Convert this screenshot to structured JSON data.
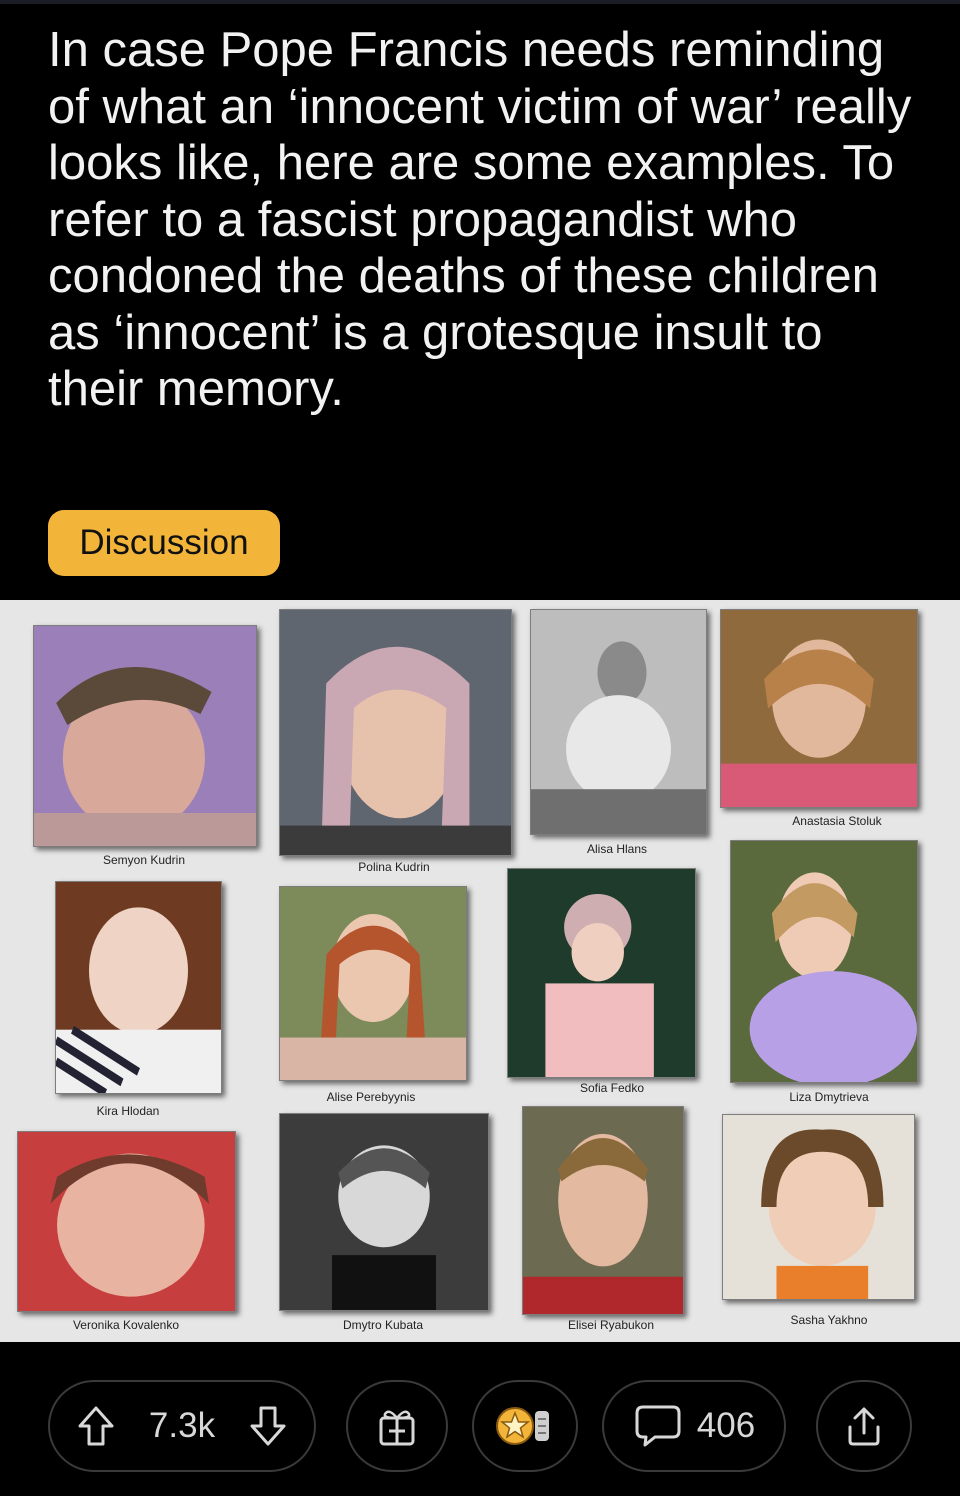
{
  "post": {
    "title": "In case Pope Francis needs reminding of what an ‘innocent victim of war’ really looks like, here are some examples. To refer to a fascist propagandist who condoned the deaths of these children as ‘innocent’ is a grotesque insult to their memory.",
    "flair": "Discussion"
  },
  "image": {
    "names": [
      "Semyon Kudrin",
      "Polina Kudrin",
      "Alisa Hlans",
      "Anastasia Stoluk",
      "Kira Hlodan",
      "Alise Perebyynis",
      "Sofia Fedko",
      "Liza Dmytrieva",
      "Veronika Kovalenko",
      "Dmytro Kubata",
      "Elisei Ryabukon",
      "Sasha Yakhno"
    ]
  },
  "actions": {
    "upvote_icon": "arrow-up-icon",
    "downvote_icon": "arrow-down-icon",
    "votes": "7.3k",
    "gift_icon": "gift-icon",
    "award_icon": "award-icon",
    "comment_icon": "comment-bubble-icon",
    "comments": "406",
    "share_icon": "share-icon",
    "colors": {
      "flair": "#f2b53a",
      "background": "#000000",
      "text": "#f2f2f2"
    }
  }
}
